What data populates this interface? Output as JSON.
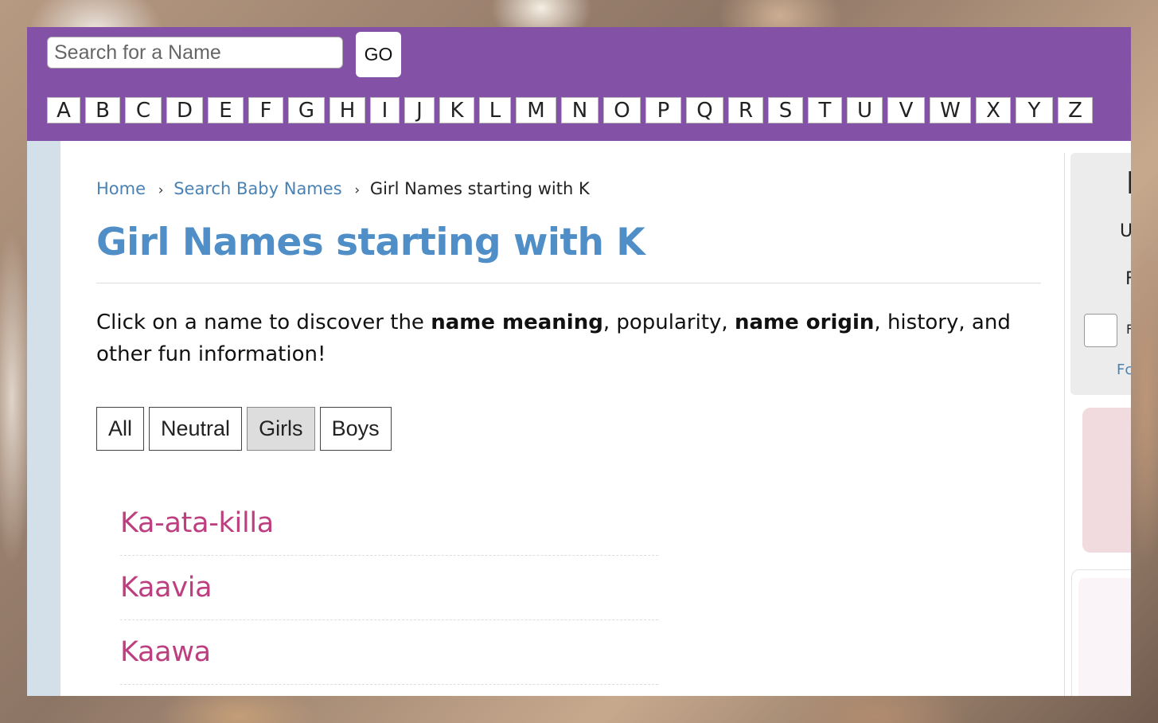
{
  "search": {
    "placeholder": "Search for a Name",
    "go_label": "GO"
  },
  "alphabet": [
    "A",
    "B",
    "C",
    "D",
    "E",
    "F",
    "G",
    "H",
    "I",
    "J",
    "K",
    "L",
    "M",
    "N",
    "O",
    "P",
    "Q",
    "R",
    "S",
    "T",
    "U",
    "V",
    "W",
    "X",
    "Y",
    "Z"
  ],
  "breadcrumb": {
    "home": "Home",
    "search": "Search Baby Names",
    "current": "Girl Names starting with K",
    "separator": "›"
  },
  "page_title": "Girl Names starting with K",
  "intro": {
    "part1": "Click on a name to discover the ",
    "bold1": "name meaning",
    "part2": ", popularity, ",
    "bold2": "name origin",
    "part3": ", history, and other fun information!"
  },
  "filters": [
    {
      "label": "All",
      "active": false
    },
    {
      "label": "Neutral",
      "active": false
    },
    {
      "label": "Girls",
      "active": true
    },
    {
      "label": "Boys",
      "active": false
    }
  ],
  "names": [
    "Ka-ata-killa",
    "Kaavia",
    "Kaawa"
  ],
  "sidebar": {
    "fragment_1": "I",
    "fragment_2": "U",
    "fragment_3": "F",
    "fragment_4": "F",
    "fragment_5": "Fc"
  },
  "colors": {
    "header": "#8351a5",
    "title": "#4f8ec6",
    "name_link": "#bd3f7f",
    "breadcrumb_link": "#4a82b4"
  }
}
